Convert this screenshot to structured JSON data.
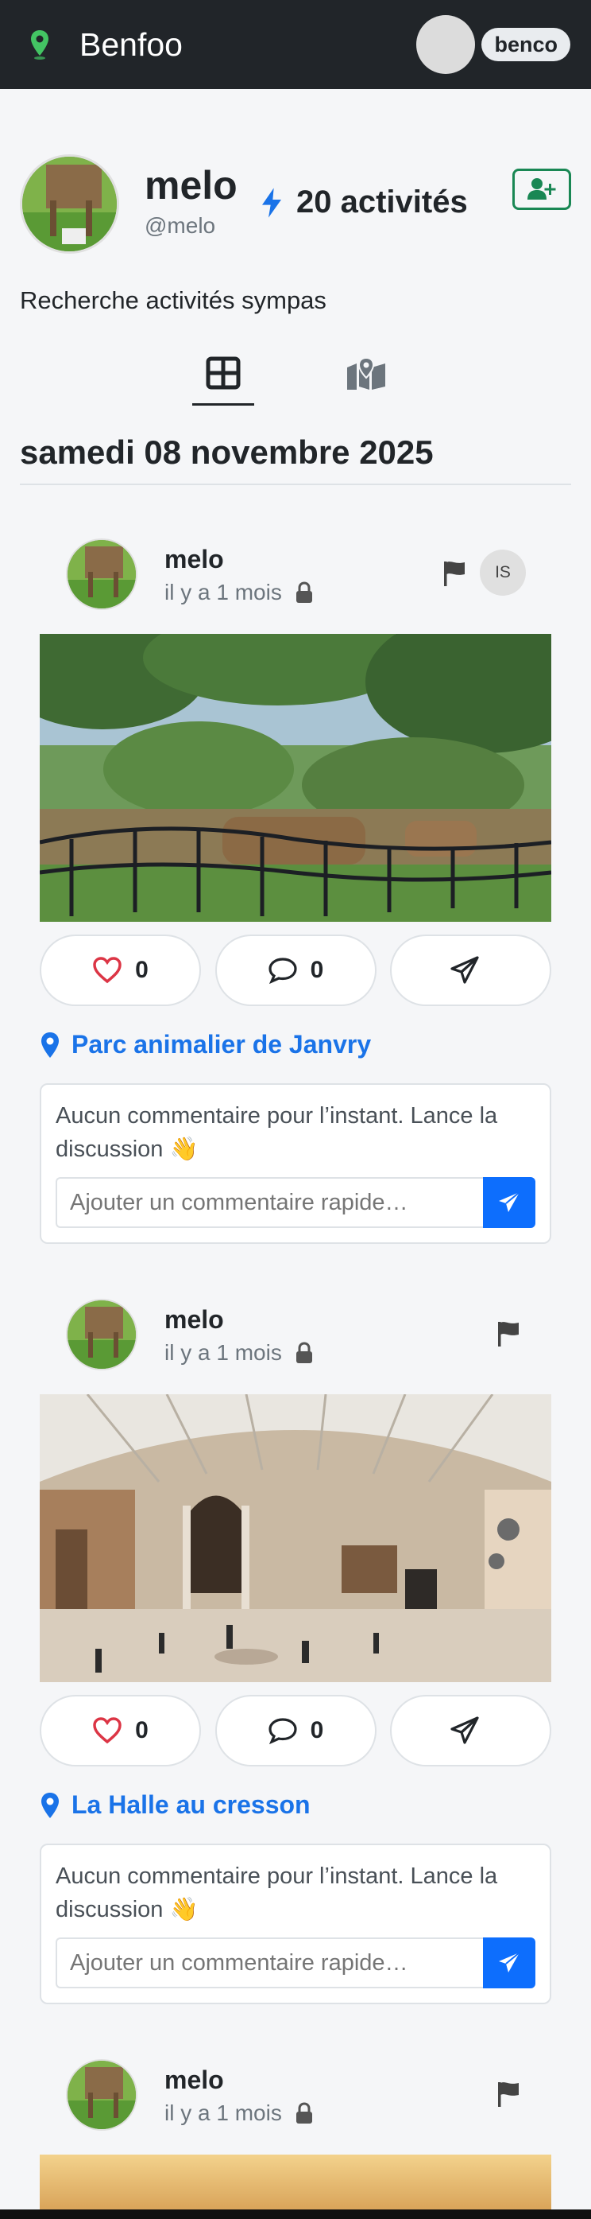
{
  "navbar": {
    "brand": "Benfoo",
    "user_label": "benco",
    "brand_color": "#43c463"
  },
  "profile": {
    "name": "melo",
    "handle": "@melo",
    "activities": "20 activités",
    "bio": "Recherche activités sympas"
  },
  "view_tabs": [
    {
      "icon": "grid-icon",
      "active": true
    },
    {
      "icon": "map-icon",
      "active": false
    }
  ],
  "date_heading": "samedi 08 novembre 2025",
  "posts": [
    {
      "author": "melo",
      "time": "il y a 1 mois",
      "badge": "IS",
      "photo": "camels-zoo-photo",
      "likes": "0",
      "comments": "0",
      "location": "Parc animalier de Janvry",
      "empty_comments": "Aucun commentaire pour l’instant. Lance la discussion 👋",
      "comment_placeholder": "Ajouter un commentaire rapide…"
    },
    {
      "author": "melo",
      "time": "il y a 1 mois",
      "badge": "",
      "photo": "museum-hall-photo",
      "likes": "0",
      "comments": "0",
      "location": "La Halle au cresson",
      "empty_comments": "Aucun commentaire pour l’instant. Lance la discussion 👋",
      "comment_placeholder": "Ajouter un commentaire rapide…"
    },
    {
      "author": "melo",
      "time": "il y a 1 mois",
      "photo": "sunset-photo"
    }
  ],
  "colors": {
    "accent": "#0d6efd",
    "link": "#1a73e8",
    "like": "#dc3545",
    "follow": "#198754"
  }
}
